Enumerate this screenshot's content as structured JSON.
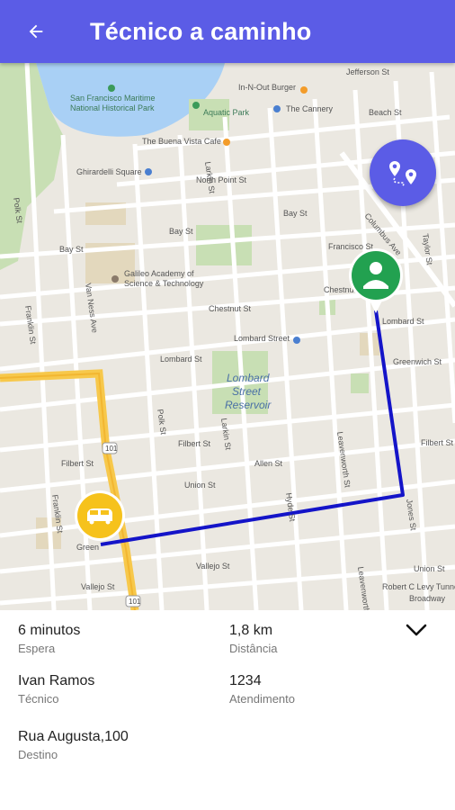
{
  "header": {
    "title": "Técnico a caminho"
  },
  "colors": {
    "primary": "#5b5ce6",
    "route": "#1414c8",
    "user_marker": "#22a150",
    "tech_marker": "#f6c21c",
    "highway": "#f7c84b"
  },
  "map": {
    "labels": {
      "in_n_out": "In-N-Out Burger",
      "jefferson": "Jefferson St",
      "maritime": "San Francisco Maritime",
      "maritime2": "National Historical Park",
      "aquatic": "Aquatic Park",
      "cannery": "The Cannery",
      "beach": "Beach St",
      "buena_vista": "The Buena Vista Cafe",
      "ghirardelli": "Ghirardelli Square",
      "north_point": "North Point St",
      "bay1": "Bay St",
      "bay2": "Bay St",
      "francisco": "Francisco St",
      "columbus": "Columbus Ave",
      "galileo1": "Galileo Academy of",
      "galileo2": "Science & Technology",
      "chestnut": "Chestnut St",
      "lombard1": "Lombard St",
      "lombard2": "Lombard Street",
      "lombard3": "Lombard St",
      "reservoir1": "Lombard",
      "reservoir2": "Street",
      "reservoir3": "Reservoir",
      "greenwich": "Greenwich St",
      "filbert1": "Filbert St",
      "filbert2": "Filbert St",
      "union": "Union St",
      "allen": "Allen St",
      "vallejo1": "Vallejo St",
      "vallejo2": "Vallejo St",
      "van_ness": "Van Ness Ave",
      "larkin": "Larkin St",
      "hyde": "Hyde St",
      "leavenworth": "Leavenworth St",
      "jones": "Jones St",
      "franklin": "Franklin St",
      "polk": "Polk St",
      "robert": "Robert C Levy Tunnel",
      "union2": "Union St",
      "green": "Green",
      "broadway": "Broadway",
      "us101": "101",
      "taylor": "Taylor St"
    }
  },
  "details": {
    "wait_value": "6 minutos",
    "wait_label": "Espera",
    "distance_value": "1,8 km",
    "distance_label": "Distância",
    "tech_value": "Ivan Ramos",
    "tech_label": "Técnico",
    "service_value": "1234",
    "service_label": "Atendimento",
    "dest_value": "Rua Augusta,100",
    "dest_label": "Destino"
  }
}
